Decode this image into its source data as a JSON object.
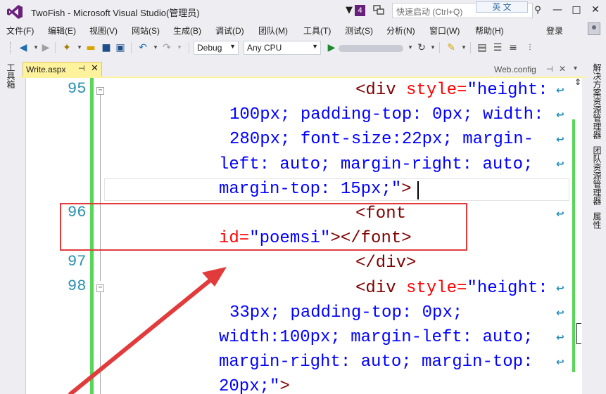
{
  "window": {
    "title": "TwoFish - Microsoft Visual Studio(管理员)",
    "notifications_count": "4",
    "quick_launch_placeholder": "快速启动 (Ctrl+Q)",
    "ime_indicator": "英 文",
    "controls": {
      "minimize": "—",
      "maximize": "□",
      "close": "✕"
    }
  },
  "menu": {
    "items": [
      "文件(F)",
      "编辑(E)",
      "视图(V)",
      "网站(S)",
      "生成(B)",
      "调试(D)",
      "团队(M)",
      "工具(T)",
      "测试(S)",
      "分析(N)",
      "窗口(W)",
      "帮助(H)"
    ],
    "login": "登录"
  },
  "toolbar": {
    "configuration": "Debug",
    "platform": "Any CPU"
  },
  "left_strip": {
    "toolbox": "工具箱"
  },
  "right_strip": {
    "items": [
      "解决方案资源管理器",
      "团队资源管理器",
      "属性"
    ]
  },
  "tabs": {
    "active": {
      "label": "Write.aspx",
      "pin": "⊣",
      "close": "✕"
    },
    "secondary": {
      "label": "Web.config",
      "pin": "⊣",
      "close": "✕",
      "dropdown": "▾"
    }
  },
  "editor": {
    "line_numbers": [
      "95",
      "96",
      "97",
      "98"
    ],
    "lines": {
      "l95a_tag": "<div",
      "l95a_attr": "style=",
      "l95a_val": "\"height:",
      "l95b": "100px; padding-top: 0px; width:",
      "l95c": "280px; font-size:22px; margin-",
      "l95d": "left: auto; margin-right: auto;",
      "l95e": "margin-top: 15px;\"",
      "l95e_end": ">",
      "l96a": "<font",
      "l96b_attr": "id=",
      "l96b_val": "\"poemsi\"",
      "l96b_end": "></font>",
      "l97": "</div>",
      "l98a_tag": "<div",
      "l98a_attr": "style=",
      "l98a_val": "\"height:",
      "l98b": "33px; padding-top: 0px;",
      "l98c": "width:100px; margin-left: auto;",
      "l98d": "margin-right: auto; margin-top:",
      "l98e_val": "20px;\"",
      "l98e_end": ">"
    }
  },
  "colors": {
    "tag": "#800000",
    "attribute": "#ff0000",
    "value": "#0000ff",
    "line_number": "#2b91af",
    "change_bar": "#57d657",
    "annotation": "#e23b3b",
    "vs_purple": "#68217a",
    "tab_active": "#fff29d"
  },
  "icons": [
    "vs-logo-icon",
    "flag-icon",
    "feedback-icon",
    "search-icon",
    "back-icon",
    "forward-icon",
    "new-project-icon",
    "open-icon",
    "save-icon",
    "save-all-icon",
    "undo-icon",
    "redo-icon",
    "start-icon",
    "refresh-icon",
    "browser-link-icon",
    "wrap-icon",
    "fold-icon"
  ]
}
